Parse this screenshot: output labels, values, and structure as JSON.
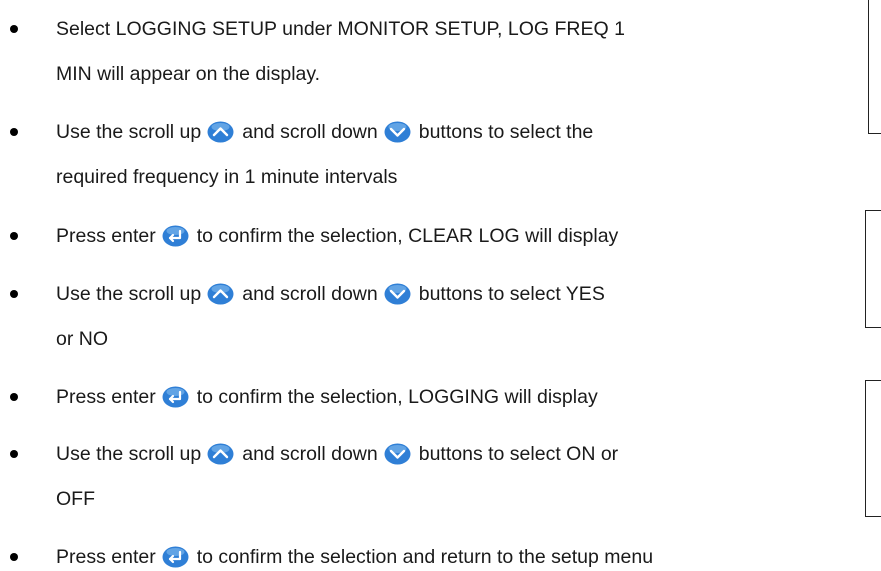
{
  "colors": {
    "button_blue": "#2f7fd6",
    "button_highlight": "#8cc3f2",
    "text": "#1a1a1a"
  },
  "icons": {
    "scroll_up": "scroll-up-button-icon",
    "scroll_down": "scroll-down-button-icon",
    "enter": "enter-button-icon"
  },
  "steps": [
    {
      "line1": "Select LOGGING SETUP under MONITOR SETUP, LOG FREQ 1",
      "line2": "MIN will appear on the display."
    },
    {
      "before_up": "Use the scroll up",
      "between": "and scroll down",
      "after_down": "buttons to select the",
      "line2": "required frequency in 1 minute intervals"
    },
    {
      "before_enter": "Press enter",
      "after_enter": "to confirm the selection, CLEAR LOG will display"
    },
    {
      "before_up": "Use the scroll up",
      "between": "and scroll down",
      "after_down": "buttons to select YES",
      "line2": "or NO"
    },
    {
      "before_enter": "Press enter",
      "after_enter": "to confirm the selection, LOGGING will display"
    },
    {
      "before_up": "Use the scroll up",
      "between": "and scroll down",
      "after_down": "buttons to select ON or",
      "line2": "OFF"
    },
    {
      "before_enter": "Press enter",
      "after_enter": "to confirm the selection and return to the setup menu"
    }
  ]
}
